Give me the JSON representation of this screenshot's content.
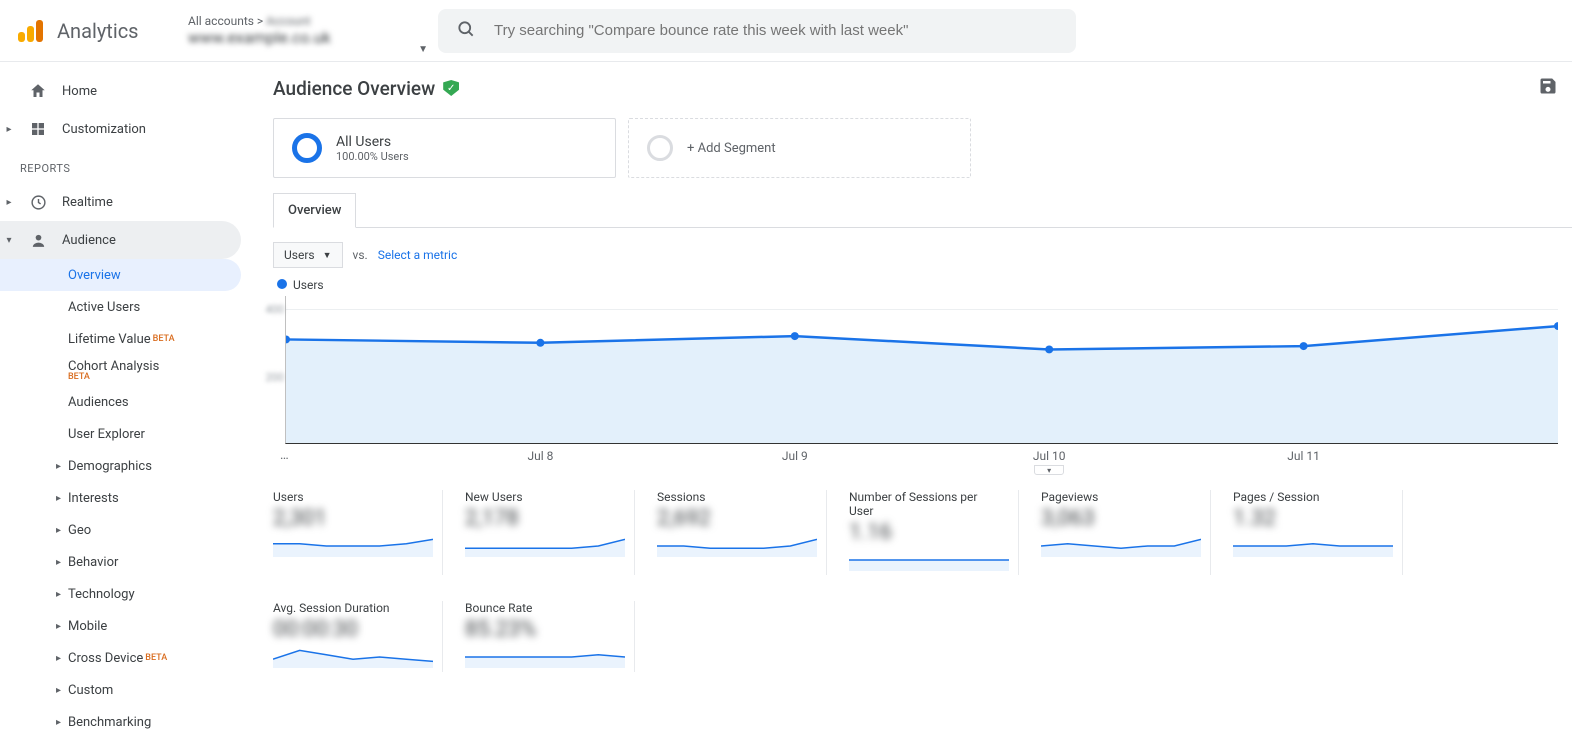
{
  "header": {
    "logo_text": "Analytics",
    "breadcrumb_prefix": "All accounts",
    "breadcrumb_sep": " > ",
    "breadcrumb_account": "Account",
    "domain": "www.example.co.uk",
    "search_placeholder": "Try searching \"Compare bounce rate this week with last week\""
  },
  "sidebar": {
    "home": "Home",
    "customization": "Customization",
    "reports_label": "REPORTS",
    "realtime": "Realtime",
    "audience": "Audience",
    "audience_sub": {
      "overview": "Overview",
      "active_users": "Active Users",
      "lifetime_value": "Lifetime Value",
      "cohort": "Cohort Analysis",
      "audiences": "Audiences",
      "user_explorer": "User Explorer",
      "demographics": "Demographics",
      "interests": "Interests",
      "geo": "Geo",
      "behavior": "Behavior",
      "technology": "Technology",
      "mobile": "Mobile",
      "cross_device": "Cross Device",
      "custom": "Custom",
      "benchmarking": "Benchmarking"
    },
    "beta": "BETA"
  },
  "page": {
    "title": "Audience Overview",
    "segment_all_title": "All Users",
    "segment_all_sub": "100.00% Users",
    "add_segment": "+ Add Segment",
    "tab_overview": "Overview",
    "metric_selector": "Users",
    "vs": "vs.",
    "select_metric": "Select a metric",
    "legend_label": "Users"
  },
  "chart_data": {
    "type": "line",
    "series": [
      {
        "name": "Users",
        "values": [
          310,
          300,
          320,
          280,
          290,
          350
        ]
      }
    ],
    "categories": [
      "…",
      "Jul 8",
      "Jul 9",
      "Jul 10",
      "Jul 11",
      ""
    ],
    "y_ticks": [
      "400",
      "200"
    ],
    "ylim": [
      0,
      440
    ],
    "title": "Users"
  },
  "kpis": [
    {
      "label": "Users",
      "value": "2,301"
    },
    {
      "label": "New Users",
      "value": "2,178"
    },
    {
      "label": "Sessions",
      "value": "2,692"
    },
    {
      "label": "Number of Sessions per User",
      "value": "1.16"
    },
    {
      "label": "Pageviews",
      "value": "3,063"
    },
    {
      "label": "Pages / Session",
      "value": "1.32"
    },
    {
      "label": "Avg. Session Duration",
      "value": "00:00:30"
    },
    {
      "label": "Bounce Rate",
      "value": "85.23%"
    }
  ]
}
